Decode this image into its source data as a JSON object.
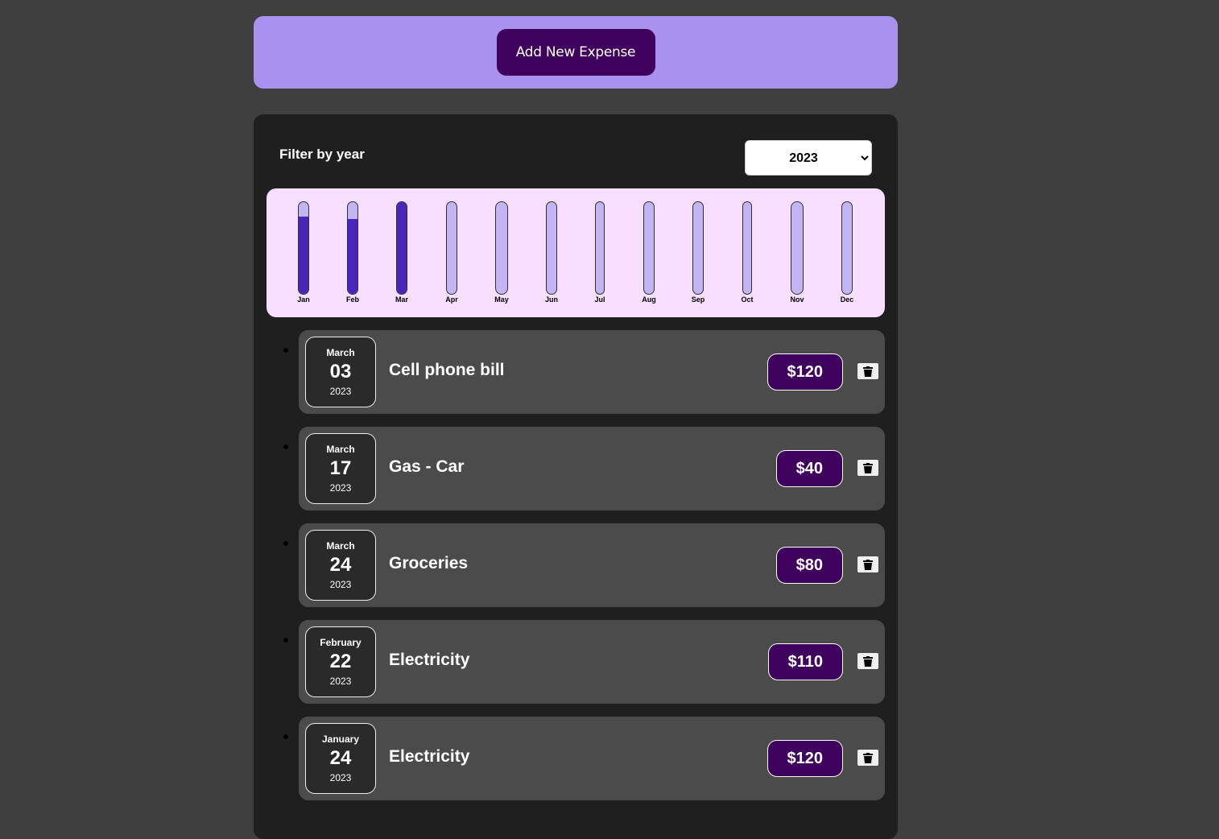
{
  "new_expense": {
    "button_label": "Add New Expense"
  },
  "filter": {
    "label": "Filter by year",
    "selected_year": "2023"
  },
  "chart_data": {
    "type": "bar",
    "categories": [
      "Jan",
      "Feb",
      "Mar",
      "Apr",
      "May",
      "Jun",
      "Jul",
      "Aug",
      "Sep",
      "Oct",
      "Nov",
      "Dec"
    ],
    "fill_fraction": [
      0.84,
      0.82,
      1.0,
      0,
      0,
      0,
      0,
      0,
      0,
      0,
      0,
      0
    ],
    "title": "",
    "xlabel": "",
    "ylabel": ""
  },
  "expenses": [
    {
      "month": "March",
      "day": "03",
      "year": "2023",
      "title": "Cell phone bill",
      "amount": "$120"
    },
    {
      "month": "March",
      "day": "17",
      "year": "2023",
      "title": "Gas - Car",
      "amount": "$40"
    },
    {
      "month": "March",
      "day": "24",
      "year": "2023",
      "title": "Groceries",
      "amount": "$80"
    },
    {
      "month": "February",
      "day": "22",
      "year": "2023",
      "title": "Electricity",
      "amount": "$110"
    },
    {
      "month": "January",
      "day": "24",
      "year": "2023",
      "title": "Electricity",
      "amount": "$120"
    }
  ],
  "colors": {
    "accent": "#40005d",
    "bar_fill": "#4826b9",
    "bar_empty": "#c3b4f3",
    "chart_bg": "#f8dfff",
    "header_bg": "#a892ee"
  }
}
